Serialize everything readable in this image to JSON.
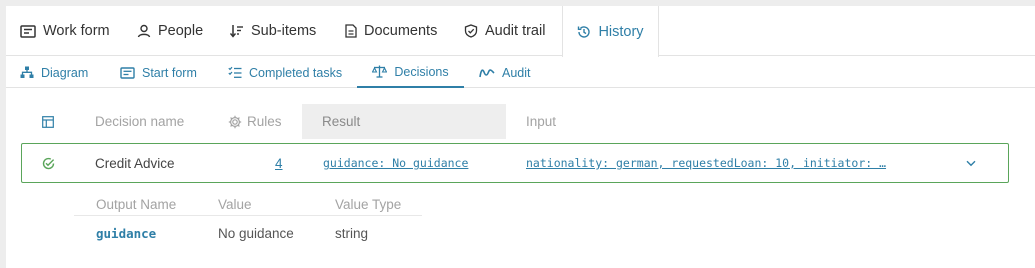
{
  "primary_tabs": [
    {
      "label": "Work form",
      "icon": "form-icon"
    },
    {
      "label": "People",
      "icon": "person-icon"
    },
    {
      "label": "Sub-items",
      "icon": "sort-icon"
    },
    {
      "label": "Documents",
      "icon": "document-icon"
    },
    {
      "label": "Audit trail",
      "icon": "shield-check-icon"
    },
    {
      "label": "History",
      "icon": "history-icon",
      "active": true
    }
  ],
  "secondary_tabs": [
    {
      "label": "Diagram",
      "icon": "diagram-icon"
    },
    {
      "label": "Start form",
      "icon": "form-icon"
    },
    {
      "label": "Completed tasks",
      "icon": "checklist-icon"
    },
    {
      "label": "Decisions",
      "icon": "scale-icon",
      "active": true
    },
    {
      "label": "Audit",
      "icon": "wave-icon"
    }
  ],
  "decisions_table": {
    "headers": {
      "name": "Decision name",
      "rules": "Rules",
      "result": "Result",
      "input": "Input"
    },
    "rows": [
      {
        "name": "Credit Advice",
        "rules": "4",
        "result": "guidance: No guidance",
        "input": "nationality: german, requestedLoan: 10, initiator: …",
        "status": "success"
      }
    ]
  },
  "output_table": {
    "headers": {
      "output_name": "Output Name",
      "value": "Value",
      "value_type": "Value Type"
    },
    "rows": [
      {
        "output_name": "guidance",
        "value": "No guidance",
        "value_type": "string"
      }
    ]
  },
  "colors": {
    "accent": "#2f7fa7",
    "success": "#5aa55a",
    "muted": "#a3a3a3"
  }
}
